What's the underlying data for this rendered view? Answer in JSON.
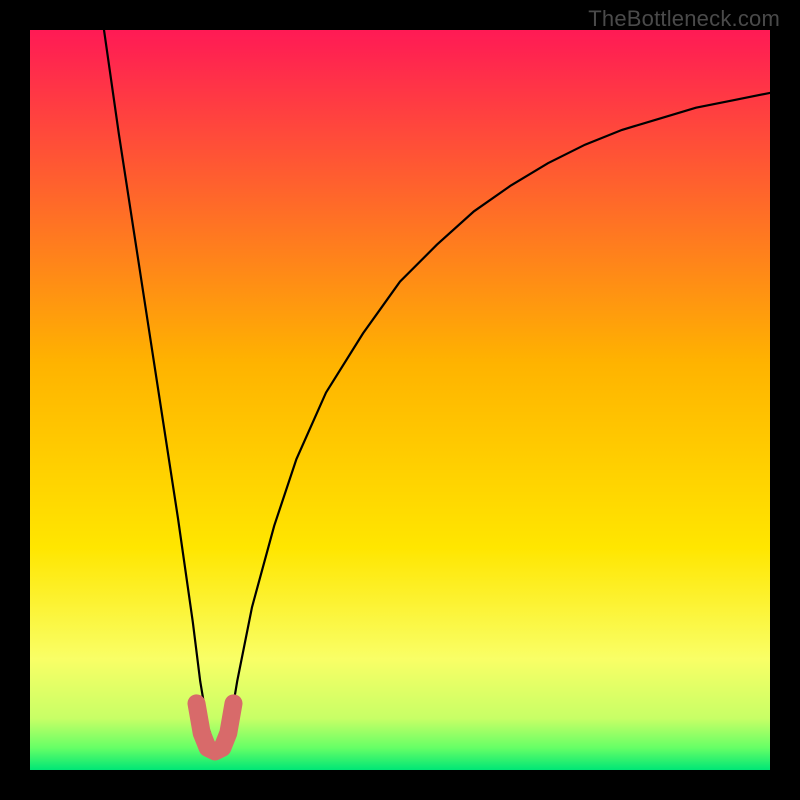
{
  "watermark": "TheBottleneck.com",
  "chart_data": {
    "type": "line",
    "title": "",
    "xlabel": "",
    "ylabel": "",
    "xlim": [
      0,
      100
    ],
    "ylim": [
      0,
      100
    ],
    "series": [
      {
        "name": "bottleneck-curve",
        "x": [
          10,
          12,
          14,
          16,
          18,
          20,
          21,
          22,
          23,
          24,
          25,
          26,
          27,
          28,
          30,
          33,
          36,
          40,
          45,
          50,
          55,
          60,
          65,
          70,
          75,
          80,
          85,
          90,
          95,
          100
        ],
        "y": [
          100,
          86,
          73,
          60,
          47,
          34,
          27,
          20,
          12,
          6,
          3,
          3,
          6,
          12,
          22,
          33,
          42,
          51,
          59,
          66,
          71,
          75.5,
          79,
          82,
          84.5,
          86.5,
          88,
          89.5,
          90.5,
          91.5
        ]
      },
      {
        "name": "optimal-zone-marker",
        "x": [
          22.5,
          23.2,
          24.0,
          25.0,
          26.0,
          26.8,
          27.5
        ],
        "y": [
          9,
          5,
          3,
          2.5,
          3,
          5,
          9
        ]
      }
    ],
    "background_gradient_stops": [
      {
        "pos": 0,
        "color": "#ff1a55"
      },
      {
        "pos": 45,
        "color": "#ffb300"
      },
      {
        "pos": 70,
        "color": "#ffe600"
      },
      {
        "pos": 85,
        "color": "#f9ff66"
      },
      {
        "pos": 93,
        "color": "#c8ff66"
      },
      {
        "pos": 97,
        "color": "#66ff66"
      },
      {
        "pos": 100,
        "color": "#00e676"
      }
    ]
  }
}
